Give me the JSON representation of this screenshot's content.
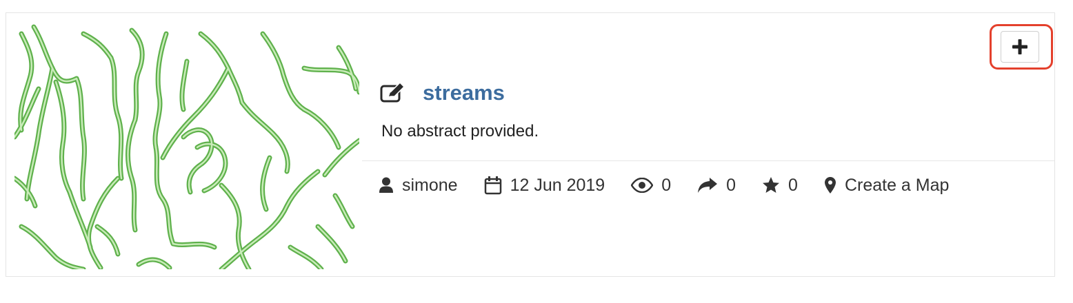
{
  "layer": {
    "title": "streams",
    "abstract": "No abstract provided.",
    "owner": "simone",
    "date": "12 Jun 2019",
    "views": "0",
    "shares": "0",
    "favorites": "0",
    "create_map_label": "Create a Map"
  },
  "icons": {
    "edit": "edit-icon",
    "add": "plus-icon",
    "owner": "user-icon",
    "date": "calendar-icon",
    "views": "eye-icon",
    "shares": "share-icon",
    "favorites": "star-icon",
    "create_map": "map-marker-icon"
  },
  "colors": {
    "title": "#3c6c9e",
    "stream_stroke": "#6bbf59",
    "highlight": "#e4402c"
  }
}
